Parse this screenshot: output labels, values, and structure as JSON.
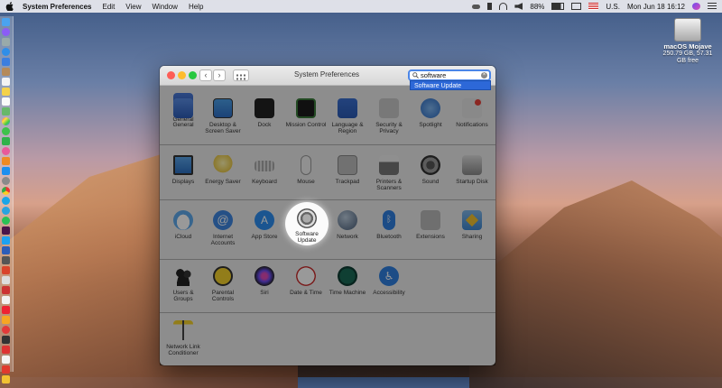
{
  "menubar": {
    "app": "System Preferences",
    "items": [
      "Edit",
      "View",
      "Window",
      "Help"
    ],
    "battery": "88%",
    "input_source": "U.S.",
    "clock": "Mon Jun 18  16:12"
  },
  "desktop": {
    "drive_name": "macOS Mojave",
    "drive_info": "250.79 GB, 57.31 GB free"
  },
  "window": {
    "title": "System Preferences",
    "back": "‹",
    "forward": "›",
    "search_value": "software",
    "search_suggestion": "Software Update"
  },
  "panes": {
    "row1": [
      "General",
      "Desktop & Screen Saver",
      "Dock",
      "Mission Control",
      "Language & Region",
      "Security & Privacy",
      "Spotlight",
      "Notifications"
    ],
    "row2": [
      "Displays",
      "Energy Saver",
      "Keyboard",
      "Mouse",
      "Trackpad",
      "Printers & Scanners",
      "Sound",
      "Startup Disk"
    ],
    "row3": [
      "iCloud",
      "Internet Accounts",
      "App Store",
      "Software Update",
      "Network",
      "Bluetooth",
      "Extensions",
      "Sharing"
    ],
    "row4": [
      "Users & Groups",
      "Parental Controls",
      "Siri",
      "Date & Time",
      "Time Machine",
      "Accessibility"
    ],
    "row5": [
      "Network Link Conditioner"
    ]
  },
  "colors": {
    "search_highlight": "#2d68d8",
    "close": "#fd5e57",
    "minimize": "#febc2e",
    "zoom": "#28c840"
  }
}
